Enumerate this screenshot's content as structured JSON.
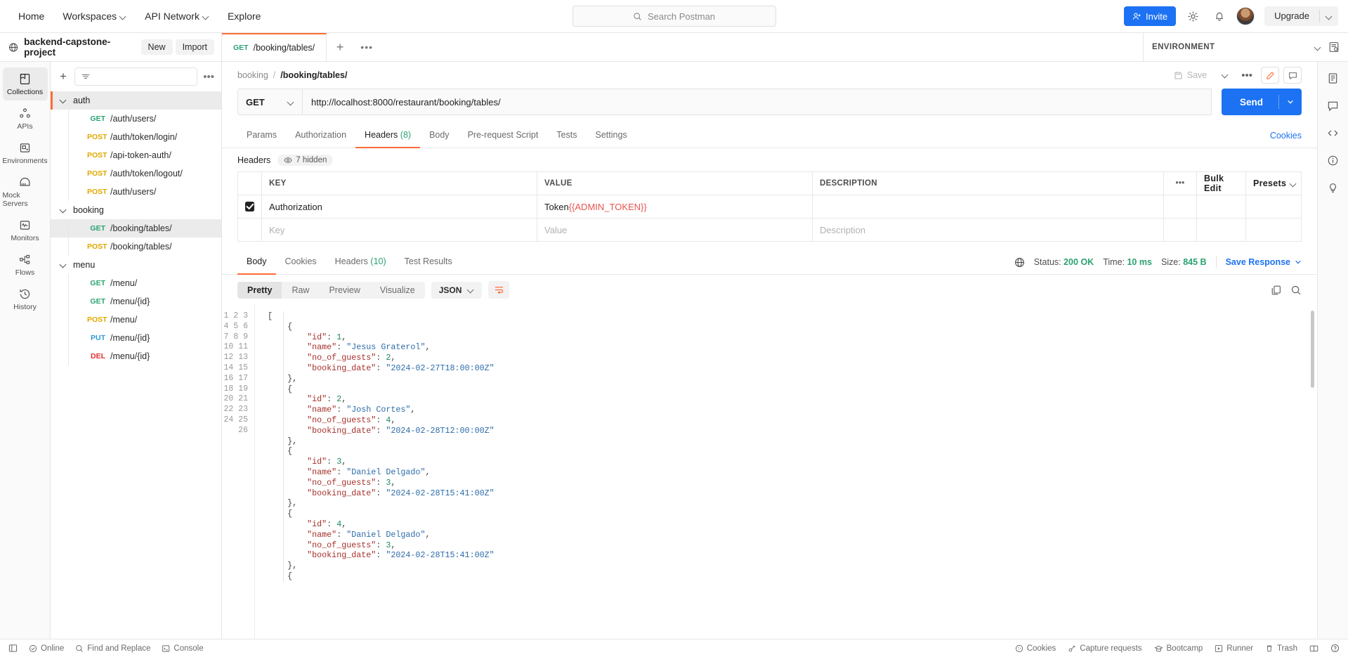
{
  "topnav": {
    "items": [
      {
        "label": "Home",
        "caret": false
      },
      {
        "label": "Workspaces",
        "caret": true
      },
      {
        "label": "API Network",
        "caret": true
      },
      {
        "label": "Explore",
        "caret": false
      }
    ],
    "search_placeholder": "Search Postman",
    "invite_label": "Invite",
    "upgrade_label": "Upgrade",
    "accent_blue": "#1c72f2",
    "accent_orange": "#ff6c37"
  },
  "workbar": {
    "workspace_name": "backend-capstone-project",
    "new_label": "New",
    "import_label": "Import",
    "tab": {
      "method": "GET",
      "name": "/booking/tables/"
    },
    "environment_label": "ENVIRONMENT"
  },
  "rail": {
    "items": [
      {
        "label": "Collections",
        "icon": "collections-icon",
        "active": true
      },
      {
        "label": "APIs",
        "icon": "apis-icon",
        "active": false
      },
      {
        "label": "Environments",
        "icon": "environments-icon",
        "active": false
      },
      {
        "label": "Mock Servers",
        "icon": "mock-servers-icon",
        "active": false
      },
      {
        "label": "Monitors",
        "icon": "monitors-icon",
        "active": false
      },
      {
        "label": "Flows",
        "icon": "flows-icon",
        "active": false
      },
      {
        "label": "History",
        "icon": "history-icon",
        "active": false
      }
    ]
  },
  "sidebar": {
    "filter_placeholder": "",
    "tree": [
      {
        "type": "folder",
        "label": "auth",
        "selected": true
      },
      {
        "type": "request",
        "method": "GET",
        "label": "/auth/users/",
        "selected": false
      },
      {
        "type": "request",
        "method": "POST",
        "label": "/auth/token/login/",
        "selected": false
      },
      {
        "type": "request",
        "method": "POST",
        "label": "/api-token-auth/",
        "selected": false
      },
      {
        "type": "request",
        "method": "POST",
        "label": "/auth/token/logout/",
        "selected": false
      },
      {
        "type": "request",
        "method": "POST",
        "label": "/auth/users/",
        "selected": false
      },
      {
        "type": "folder",
        "label": "booking",
        "selected": false
      },
      {
        "type": "request",
        "method": "GET",
        "label": "/booking/tables/",
        "selected": true
      },
      {
        "type": "request",
        "method": "POST",
        "label": "/booking/tables/",
        "selected": false
      },
      {
        "type": "folder",
        "label": "menu",
        "selected": false
      },
      {
        "type": "request",
        "method": "GET",
        "label": "/menu/",
        "selected": false
      },
      {
        "type": "request",
        "method": "GET",
        "label": "/menu/{id}",
        "selected": false
      },
      {
        "type": "request",
        "method": "POST",
        "label": "/menu/",
        "selected": false
      },
      {
        "type": "request",
        "method": "PUT",
        "label": "/menu/{id}",
        "selected": false
      },
      {
        "type": "request",
        "method": "DEL",
        "label": "/menu/{id}",
        "selected": false
      }
    ]
  },
  "request": {
    "breadcrumb_parent": "booking",
    "breadcrumb_sep": "/",
    "breadcrumb_current": "/booking/tables/",
    "save_label": "Save",
    "method": "GET",
    "url": "http://localhost:8000/restaurant/booking/tables/",
    "send_label": "Send",
    "tabs": [
      {
        "label": "Params",
        "count": "",
        "active": false
      },
      {
        "label": "Authorization",
        "count": "",
        "active": false
      },
      {
        "label": "Headers",
        "count": "(8)",
        "active": true
      },
      {
        "label": "Body",
        "count": "",
        "active": false
      },
      {
        "label": "Pre-request Script",
        "count": "",
        "active": false
      },
      {
        "label": "Tests",
        "count": "",
        "active": false
      },
      {
        "label": "Settings",
        "count": "",
        "active": false
      }
    ],
    "cookies_link": "Cookies",
    "headers_section_title": "Headers",
    "hidden_pill": "7 hidden",
    "table": {
      "columns": [
        "KEY",
        "VALUE",
        "DESCRIPTION"
      ],
      "bulk_edit_label": "Bulk Edit",
      "presets_label": "Presets",
      "rows": [
        {
          "checked": true,
          "key": "Authorization",
          "value_prefix": "Token ",
          "value_variable": "{{ADMIN_TOKEN}}",
          "description": ""
        }
      ],
      "placeholder_row": {
        "key": "Key",
        "value": "Value",
        "description": "Description"
      }
    }
  },
  "response": {
    "tabs": [
      {
        "label": "Body",
        "count": "",
        "active": true
      },
      {
        "label": "Cookies",
        "count": "",
        "active": false
      },
      {
        "label": "Headers",
        "count": "(10)",
        "active": false
      },
      {
        "label": "Test Results",
        "count": "",
        "active": false
      }
    ],
    "status_key": "Status:",
    "status_value": "200 OK",
    "time_key": "Time:",
    "time_value": "10 ms",
    "size_key": "Size:",
    "size_value": "845 B",
    "save_response_label": "Save Response",
    "formats": [
      {
        "label": "Pretty",
        "active": true
      },
      {
        "label": "Raw",
        "active": false
      },
      {
        "label": "Preview",
        "active": false
      },
      {
        "label": "Visualize",
        "active": false
      }
    ],
    "language": "JSON",
    "body_lines": [
      {
        "n": 1,
        "indent": 0,
        "tokens": [
          {
            "t": "p",
            "v": "["
          }
        ]
      },
      {
        "n": 2,
        "indent": 1,
        "tokens": [
          {
            "t": "p",
            "v": "{"
          }
        ]
      },
      {
        "n": 3,
        "indent": 2,
        "tokens": [
          {
            "t": "k",
            "v": "\"id\""
          },
          {
            "t": "p",
            "v": ": "
          },
          {
            "t": "n",
            "v": "1"
          },
          {
            "t": "p",
            "v": ","
          }
        ]
      },
      {
        "n": 4,
        "indent": 2,
        "tokens": [
          {
            "t": "k",
            "v": "\"name\""
          },
          {
            "t": "p",
            "v": ": "
          },
          {
            "t": "s",
            "v": "\"Jesus Graterol\""
          },
          {
            "t": "p",
            "v": ","
          }
        ]
      },
      {
        "n": 5,
        "indent": 2,
        "tokens": [
          {
            "t": "k",
            "v": "\"no_of_guests\""
          },
          {
            "t": "p",
            "v": ": "
          },
          {
            "t": "n",
            "v": "2"
          },
          {
            "t": "p",
            "v": ","
          }
        ]
      },
      {
        "n": 6,
        "indent": 2,
        "tokens": [
          {
            "t": "k",
            "v": "\"booking_date\""
          },
          {
            "t": "p",
            "v": ": "
          },
          {
            "t": "s",
            "v": "\"2024-02-27T18:00:00Z\""
          }
        ]
      },
      {
        "n": 7,
        "indent": 1,
        "tokens": [
          {
            "t": "p",
            "v": "},"
          }
        ]
      },
      {
        "n": 8,
        "indent": 1,
        "tokens": [
          {
            "t": "p",
            "v": "{"
          }
        ]
      },
      {
        "n": 9,
        "indent": 2,
        "tokens": [
          {
            "t": "k",
            "v": "\"id\""
          },
          {
            "t": "p",
            "v": ": "
          },
          {
            "t": "n",
            "v": "2"
          },
          {
            "t": "p",
            "v": ","
          }
        ]
      },
      {
        "n": 10,
        "indent": 2,
        "tokens": [
          {
            "t": "k",
            "v": "\"name\""
          },
          {
            "t": "p",
            "v": ": "
          },
          {
            "t": "s",
            "v": "\"Josh Cortes\""
          },
          {
            "t": "p",
            "v": ","
          }
        ]
      },
      {
        "n": 11,
        "indent": 2,
        "tokens": [
          {
            "t": "k",
            "v": "\"no_of_guests\""
          },
          {
            "t": "p",
            "v": ": "
          },
          {
            "t": "n",
            "v": "4"
          },
          {
            "t": "p",
            "v": ","
          }
        ]
      },
      {
        "n": 12,
        "indent": 2,
        "tokens": [
          {
            "t": "k",
            "v": "\"booking_date\""
          },
          {
            "t": "p",
            "v": ": "
          },
          {
            "t": "s",
            "v": "\"2024-02-28T12:00:00Z\""
          }
        ]
      },
      {
        "n": 13,
        "indent": 1,
        "tokens": [
          {
            "t": "p",
            "v": "},"
          }
        ]
      },
      {
        "n": 14,
        "indent": 1,
        "tokens": [
          {
            "t": "p",
            "v": "{"
          }
        ]
      },
      {
        "n": 15,
        "indent": 2,
        "tokens": [
          {
            "t": "k",
            "v": "\"id\""
          },
          {
            "t": "p",
            "v": ": "
          },
          {
            "t": "n",
            "v": "3"
          },
          {
            "t": "p",
            "v": ","
          }
        ]
      },
      {
        "n": 16,
        "indent": 2,
        "tokens": [
          {
            "t": "k",
            "v": "\"name\""
          },
          {
            "t": "p",
            "v": ": "
          },
          {
            "t": "s",
            "v": "\"Daniel Delgado\""
          },
          {
            "t": "p",
            "v": ","
          }
        ]
      },
      {
        "n": 17,
        "indent": 2,
        "tokens": [
          {
            "t": "k",
            "v": "\"no_of_guests\""
          },
          {
            "t": "p",
            "v": ": "
          },
          {
            "t": "n",
            "v": "3"
          },
          {
            "t": "p",
            "v": ","
          }
        ]
      },
      {
        "n": 18,
        "indent": 2,
        "tokens": [
          {
            "t": "k",
            "v": "\"booking_date\""
          },
          {
            "t": "p",
            "v": ": "
          },
          {
            "t": "s",
            "v": "\"2024-02-28T15:41:00Z\""
          }
        ]
      },
      {
        "n": 19,
        "indent": 1,
        "tokens": [
          {
            "t": "p",
            "v": "},"
          }
        ]
      },
      {
        "n": 20,
        "indent": 1,
        "tokens": [
          {
            "t": "p",
            "v": "{"
          }
        ]
      },
      {
        "n": 21,
        "indent": 2,
        "tokens": [
          {
            "t": "k",
            "v": "\"id\""
          },
          {
            "t": "p",
            "v": ": "
          },
          {
            "t": "n",
            "v": "4"
          },
          {
            "t": "p",
            "v": ","
          }
        ]
      },
      {
        "n": 22,
        "indent": 2,
        "tokens": [
          {
            "t": "k",
            "v": "\"name\""
          },
          {
            "t": "p",
            "v": ": "
          },
          {
            "t": "s",
            "v": "\"Daniel Delgado\""
          },
          {
            "t": "p",
            "v": ","
          }
        ]
      },
      {
        "n": 23,
        "indent": 2,
        "tokens": [
          {
            "t": "k",
            "v": "\"no_of_guests\""
          },
          {
            "t": "p",
            "v": ": "
          },
          {
            "t": "n",
            "v": "3"
          },
          {
            "t": "p",
            "v": ","
          }
        ]
      },
      {
        "n": 24,
        "indent": 2,
        "tokens": [
          {
            "t": "k",
            "v": "\"booking_date\""
          },
          {
            "t": "p",
            "v": ": "
          },
          {
            "t": "s",
            "v": "\"2024-02-28T15:41:00Z\""
          }
        ]
      },
      {
        "n": 25,
        "indent": 1,
        "tokens": [
          {
            "t": "p",
            "v": "},"
          }
        ]
      },
      {
        "n": 26,
        "indent": 1,
        "tokens": [
          {
            "t": "p",
            "v": "{"
          }
        ]
      }
    ]
  },
  "footer": {
    "left": [
      {
        "label": "Online",
        "icon": "status-online-icon"
      },
      {
        "label": "Find and Replace",
        "icon": "search-icon"
      },
      {
        "label": "Console",
        "icon": "console-icon"
      }
    ],
    "right": [
      {
        "label": "Cookies",
        "icon": "cookies-icon"
      },
      {
        "label": "Capture requests",
        "icon": "capture-icon"
      },
      {
        "label": "Bootcamp",
        "icon": "bootcamp-icon"
      },
      {
        "label": "Runner",
        "icon": "runner-icon"
      },
      {
        "label": "Trash",
        "icon": "trash-icon"
      }
    ]
  }
}
